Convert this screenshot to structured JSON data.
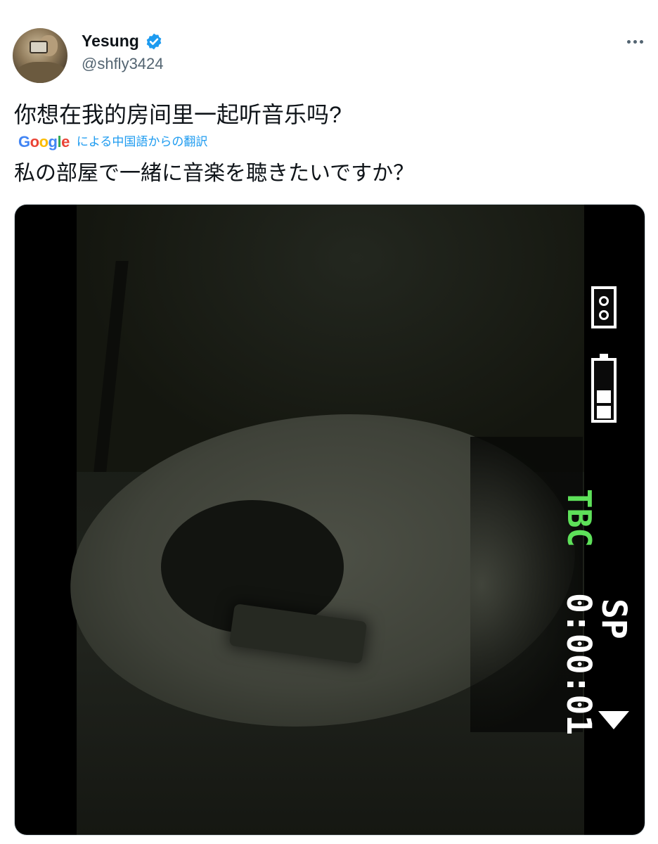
{
  "author": {
    "display_name": "Yesung",
    "handle": "@shfly3424",
    "verified_icon": "verified-badge-icon",
    "more_icon": "more-horizontal-icon"
  },
  "tweet": {
    "text": "你想在我的房间里一起听音乐吗?",
    "translation_source": "Google",
    "translation_label": "による中国語からの翻訳",
    "translated_text": "私の部屋で一緒に音楽を聴きたいですか？"
  },
  "media": {
    "type": "video",
    "osd_tbc": "TBC",
    "osd_mode": "SP",
    "osd_time": "0:00:01",
    "icons": [
      "tape-icon",
      "battery-icon",
      "play-icon"
    ],
    "osd_green": "#5ee15a",
    "osd_white": "#ffffff"
  },
  "colors": {
    "text": "#0f1419",
    "secondary": "#536471",
    "link": "#1d9bf0",
    "verified": "#1d9bf0"
  }
}
